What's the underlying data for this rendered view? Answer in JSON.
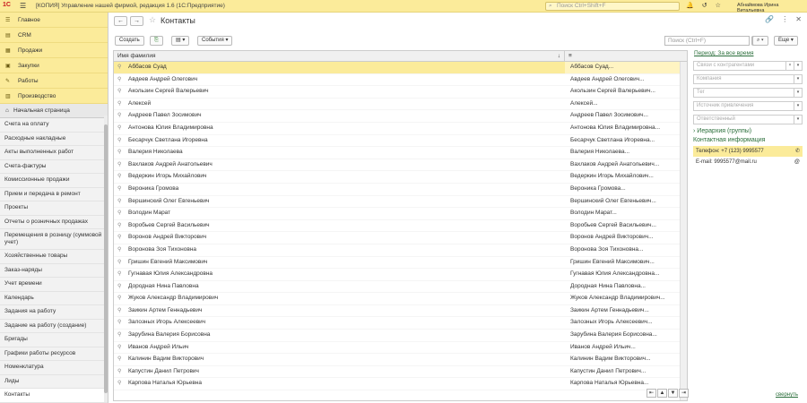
{
  "titlebar": {
    "title": "[КОПИЯ] Управление нашей фирмой, редакция 1.6  (1С:Предприятие)",
    "search_placeholder": "Поиск Ctrl+Shift+F",
    "user": "Абнаймова Ирина Витальевна"
  },
  "sections": [
    {
      "label": "Главное"
    },
    {
      "label": "CRM"
    },
    {
      "label": "Продажи"
    },
    {
      "label": "Закупки"
    },
    {
      "label": "Работы"
    },
    {
      "label": "Производство"
    }
  ],
  "home": {
    "label": "Начальная страница"
  },
  "nav": [
    {
      "label": "Счета на оплату"
    },
    {
      "label": "Расходные накладные"
    },
    {
      "label": "Акты выполненных работ"
    },
    {
      "label": "Счета-фактуры"
    },
    {
      "label": "Комиссионные продажи"
    },
    {
      "label": "Прием и передача в ремонт"
    },
    {
      "label": "Проекты"
    },
    {
      "label": "Отчеты о розничных продажах"
    },
    {
      "label": "Перемещения в розницу (суммовой учет)"
    },
    {
      "label": "Хозяйственные товары"
    },
    {
      "label": "Заказ-наряды"
    },
    {
      "label": "Учет времени"
    },
    {
      "label": "Календарь"
    },
    {
      "label": "Задания на работу"
    },
    {
      "label": "Задание на работу (создание)"
    },
    {
      "label": "Бригады"
    },
    {
      "label": "Графики работы ресурсов"
    },
    {
      "label": "Номенклатура"
    },
    {
      "label": "Лиды"
    },
    {
      "label": "Контакты"
    }
  ],
  "page": {
    "title": "Контакты"
  },
  "toolbar": {
    "create": "Создать",
    "events": "События",
    "search_placeholder": "Поиск (Ctrl+F)",
    "more": "Еще"
  },
  "grid": {
    "col1": "Имя фамилия",
    "rows": [
      {
        "name": "Аббасов Суад",
        "short": "Аббасов Суад..."
      },
      {
        "name": "Авдеев Андрей Олегович",
        "short": "Авдеев Андрей Олегович..."
      },
      {
        "name": "Акользин Сергей Валерьевич",
        "short": "Акользин Сергей Валерьевич..."
      },
      {
        "name": "Алексей",
        "short": "Алексей..."
      },
      {
        "name": "Андреев Павел Зосимович",
        "short": "Андреев Павел Зосимович..."
      },
      {
        "name": "Антонова Юлия Владимировна",
        "short": "Антонова Юлия Владимировна..."
      },
      {
        "name": "Бесарчук Светлана Игоревна",
        "short": "Бесарчук Светлана Игоревна..."
      },
      {
        "name": "Валерия Николаева",
        "short": "Валерия Николаева..."
      },
      {
        "name": "Вахлаков Андрей Анатольевич",
        "short": "Вахлаков Андрей Анатольевич..."
      },
      {
        "name": "Ведеркин Игорь Михайлович",
        "short": "Ведеркин Игорь Михайлович..."
      },
      {
        "name": "Вероника Громова",
        "short": "Вероника Громова..."
      },
      {
        "name": "Вершинский Олег Евгеньевич",
        "short": "Вершинский Олег Евгеньевич..."
      },
      {
        "name": "Володин Марат",
        "short": "Володин Марат..."
      },
      {
        "name": "Воробьев Сергей Васильевич",
        "short": "Воробьев Сергей Васильевич..."
      },
      {
        "name": "Воронов Андрей Викторович",
        "short": "Воронов Андрей Викторович..."
      },
      {
        "name": "Воронова Зоя Тихоновна",
        "short": "Воронова Зоя Тихоновна..."
      },
      {
        "name": "Гришин Евгений Максимович",
        "short": "Гришин Евгений Максимович..."
      },
      {
        "name": "Гугнавая Юлия Александровна",
        "short": "Гугнавая Юлия Александровна..."
      },
      {
        "name": "Дородная Нина Павловна",
        "short": "Дородная Нина Павловна..."
      },
      {
        "name": "Жуков Александр Владимирович",
        "short": "Жуков Александр Владимирович..."
      },
      {
        "name": "Заикин Артем Геннадьевич",
        "short": "Заикин Артем Геннадьевич..."
      },
      {
        "name": "Залозных Игорь Алексеевич",
        "short": "Залозных Игорь Алексеевич..."
      },
      {
        "name": "Зарубина Валерия Борисовна",
        "short": "Зарубина Валерия Борисовна..."
      },
      {
        "name": "Иванов Андрей Ильич",
        "short": "Иванов Андрей Ильич..."
      },
      {
        "name": "Калинин Вадим Викторович",
        "short": "Калинин Вадим Викторович..."
      },
      {
        "name": "Капустин Данил Петрович",
        "short": "Капустин Данил Петрович..."
      },
      {
        "name": "Карпова Наталья Юрьевна",
        "short": "Карпова Наталья Юрьевна..."
      }
    ]
  },
  "filters": {
    "period": "Период: За все время",
    "counterparty": "Связи с контрагентами",
    "company": "Компания",
    "tag": "Тег",
    "source": "Источник привлечения",
    "responsible": "Ответственный",
    "hierarchy": "Иерархия (группы)"
  },
  "contact": {
    "title": "Контактная информация",
    "phone": "Телефон: +7 (123) 9995577",
    "email": "E-mail: 9995577@mail.ru"
  },
  "collapse": "свернуть"
}
